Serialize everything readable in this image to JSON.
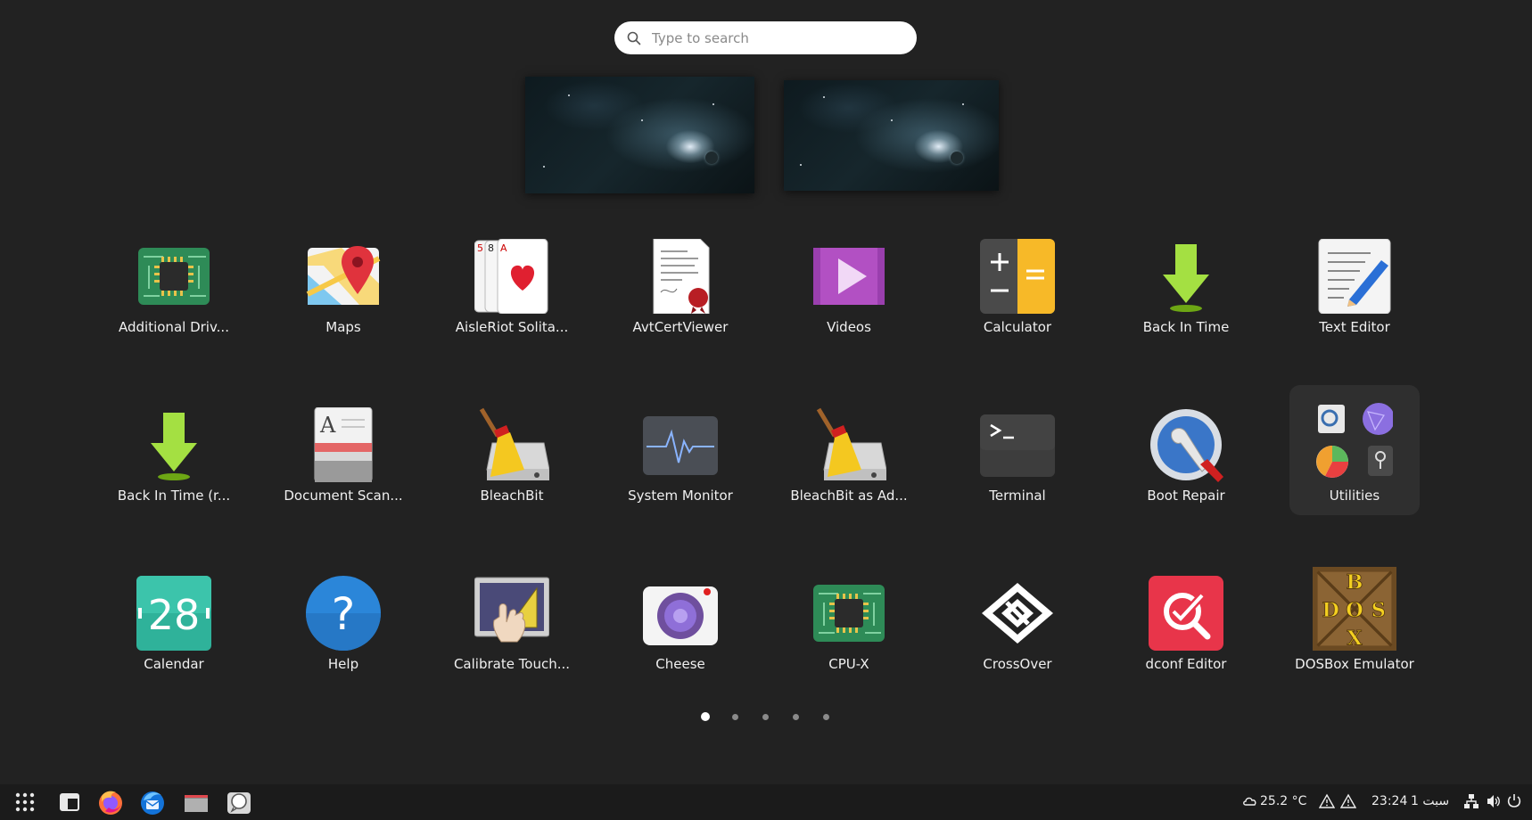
{
  "search": {
    "placeholder": "Type to search"
  },
  "apps": [
    {
      "label": "Additional Driv...",
      "icon": "chip-icon"
    },
    {
      "label": "Maps",
      "icon": "map-icon"
    },
    {
      "label": "AisleRiot Solita...",
      "icon": "cards-icon"
    },
    {
      "label": "AvtCertViewer",
      "icon": "certificate-icon"
    },
    {
      "label": "Videos",
      "icon": "video-play-icon"
    },
    {
      "label": "Calculator",
      "icon": "calculator-icon"
    },
    {
      "label": "Back In Time",
      "icon": "down-arrow-icon"
    },
    {
      "label": "Text Editor",
      "icon": "text-editor-icon"
    },
    {
      "label": "Back In Time (r...",
      "icon": "down-arrow-icon"
    },
    {
      "label": "Document Scan...",
      "icon": "scanner-icon"
    },
    {
      "label": "BleachBit",
      "icon": "broom-icon"
    },
    {
      "label": "System Monitor",
      "icon": "pulse-icon"
    },
    {
      "label": "BleachBit as Ad...",
      "icon": "broom-icon"
    },
    {
      "label": "Terminal",
      "icon": "terminal-icon"
    },
    {
      "label": "Boot Repair",
      "icon": "wrench-icon"
    },
    {
      "label": "Utilities",
      "icon": "folder-icon"
    },
    {
      "label": "Calendar",
      "icon": "calendar-icon",
      "day": "28"
    },
    {
      "label": "Help",
      "icon": "help-icon",
      "glyph": "?"
    },
    {
      "label": "Calibrate Touch...",
      "icon": "touch-icon"
    },
    {
      "label": "Cheese",
      "icon": "camera-icon"
    },
    {
      "label": "CPU-X",
      "icon": "chip-icon"
    },
    {
      "label": "CrossOver",
      "icon": "crossover-icon"
    },
    {
      "label": "dconf Editor",
      "icon": "dconf-icon"
    },
    {
      "label": "DOSBox Emulator",
      "icon": "dosbox-icon",
      "letters": [
        "B",
        "D",
        "O",
        "S",
        "X"
      ]
    }
  ],
  "pages": {
    "count": 5,
    "active": 0
  },
  "taskbar": {
    "pinned": [
      "app-grid-icon",
      "workspaces-icon",
      "firefox-icon",
      "thunderbird-icon",
      "files-icon",
      "chat-icon"
    ],
    "weather": "25.2 °C",
    "clock": "23:24",
    "date": "سبت 1",
    "tray": [
      "warning-icon",
      "warning-icon",
      "network-icon",
      "volume-icon",
      "power-icon"
    ]
  },
  "colors": {
    "background": "#222222",
    "taskbar": "#1b1b1b",
    "folder_bg": "#2f2f2f"
  }
}
